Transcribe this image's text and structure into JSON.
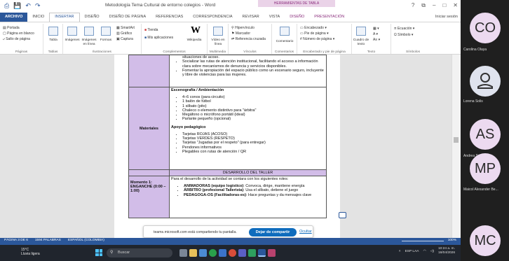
{
  "word": {
    "title": "Metodología Tema Cultural de entorno colegios - Word",
    "context_tab": "HERRAMIENTAS DE TABLA",
    "window_controls": [
      "?",
      "⧉",
      "–",
      "□",
      "✕"
    ],
    "quick_access": [
      "⎙",
      "💾",
      "↶",
      "↷"
    ],
    "signin": "Iniciar sesión",
    "tabs": [
      "ARCHIVO",
      "INICIO",
      "INSERTAR",
      "DISEÑO",
      "DISEÑO DE PÁGINA",
      "REFERENCIAS",
      "CORRESPONDENCIA",
      "REVISAR",
      "VISTA",
      "DISEÑO",
      "PRESENTACIÓN"
    ],
    "ribbon": {
      "pages": {
        "label": "Páginas",
        "items": [
          "Portada",
          "Página en blanco",
          "Salto de página"
        ]
      },
      "tables": {
        "label": "Tablas",
        "item": "Tabla"
      },
      "illustrations": {
        "label": "Ilustraciones",
        "items": [
          "Imágenes",
          "Imágenes en línea",
          "Formas",
          "SmartArt",
          "Gráfico",
          "Captura"
        ]
      },
      "addins": {
        "label": "Complementos",
        "items": [
          "Tienda",
          "Mis aplicaciones",
          "Wikipedia"
        ]
      },
      "media": {
        "label": "Multimedia",
        "item": "Vídeo en línea"
      },
      "links": {
        "label": "Vínculos",
        "items": [
          "Hipervínculo",
          "Marcador",
          "Referencia cruzada"
        ]
      },
      "comments": {
        "label": "Comentarios",
        "item": "Comentario"
      },
      "header_footer": {
        "label": "Encabezado y pie de página",
        "items": [
          "Encabezado",
          "Pie de página",
          "Número de página"
        ]
      },
      "text": {
        "label": "Texto",
        "item": "Cuadro de texto"
      },
      "symbols": {
        "label": "Símbolos",
        "items": [
          "Ecuación",
          "Símbolo"
        ]
      }
    },
    "document": {
      "top_bullets": [
        "situaciones de acoso.",
        "Socializar las rutas de atención institucional, facilitando el acceso a información clara sobre mecanismos de denuncia y servicios disponibles.",
        "Fomentar la apropiación del espacio público como un escenario seguro, incluyente y libre de violencias para las mujeres."
      ],
      "materials_label": "Materiales",
      "section1_title": "Escenografía / Ambientación",
      "section1_items": [
        "4–6 conos (para circuito)",
        "1 balón de fútbol",
        "1 silbato (pito)",
        "Chaleco o elemento distintivo para \"árbitra\"",
        "Megáfono o micrófono portátil (ideal)",
        "Parlante pequeño (opcional)"
      ],
      "section2_title": "Apoyo pedagógico",
      "section2_items": [
        "Tarjetas ROJAS (ACOSO)",
        "Tarjetas VERDES (RESPETO)",
        "Tarjetas \"Jugadas por el respeto\" (para entregar)",
        "Pendones informativos",
        "Plegables con rutas de atención / QR"
      ],
      "workshop_header": "DESARROLLO DEL TALLER",
      "moment_label": "Momento 1: ENGANCHE (0:00 – 1:00)",
      "moment_intro": "Para el desarrollo de la actividad se contara con los siguientes roles:",
      "roles": [
        {
          "bold": "ANIMADORAS (equipo logístico)",
          "rest": ": Convoca, dirige, mantiene energía"
        },
        {
          "bold": "ÁRBITRO (profesional Tallerista)",
          "rest": ": Usa el silbato, detiene el juego"
        },
        {
          "bold": "PEDAGOGA-OS (Facilitadoras-es)",
          "rest": ": Hace preguntas y da mensajes clave"
        }
      ]
    },
    "share_bar": {
      "text": "teams.microsoft.com está compartiendo tu pantalla.",
      "stop": "Dejar de compartir",
      "hide": "Ocultar"
    },
    "status": {
      "page": "PÁGINA 3 DE 6",
      "words": "1594 PALABRAS",
      "language": "ESPAÑOL (COLOMBIA)",
      "zoom": "100%"
    }
  },
  "taskbar": {
    "weather_temp": "15°C",
    "weather_desc": "Lluvia ligera",
    "search_placeholder": "Buscar",
    "tray_lang": "ESP LAA",
    "time": "10:24 a. m.",
    "date": "18/04/2026"
  },
  "participants": [
    {
      "initials": "CO",
      "name": "Carolina Olaya"
    },
    {
      "initials": "",
      "name": "Lorena Solis"
    },
    {
      "initials": "AS",
      "name": "Andrea Saray"
    },
    {
      "initials": "MP",
      "name": "Maicol Alexander Be..."
    },
    {
      "initials": "MC",
      "name": ""
    }
  ]
}
